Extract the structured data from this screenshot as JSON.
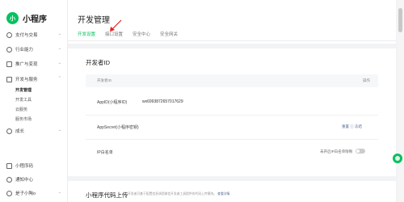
{
  "app": {
    "logo_text": "小",
    "name": "小程序"
  },
  "sidebar": {
    "items": [
      {
        "label": "支付与交易"
      },
      {
        "label": "行业能力"
      },
      {
        "label": "推广与变现"
      },
      {
        "label": "开发与服务"
      },
      {
        "label": "成长"
      },
      {
        "label": "小程序码"
      },
      {
        "label": "通知中心"
      },
      {
        "label": "是子小陶o"
      }
    ],
    "sub_items": [
      {
        "label": "开发管理"
      },
      {
        "label": "开发工具"
      },
      {
        "label": "云服务"
      },
      {
        "label": "服务市场"
      }
    ]
  },
  "header": {
    "title": "开发管理"
  },
  "tabs": [
    {
      "label": "开发设置"
    },
    {
      "label": "接口设置"
    },
    {
      "label": "安全中心"
    },
    {
      "label": "安全网关"
    }
  ],
  "developer_card": {
    "title": "开发者ID",
    "headers": {
      "id": "开发者ID",
      "action": "操作"
    },
    "rows": {
      "appid_label": "AppID(小程序ID)",
      "appid_value": "wx6993872657017629",
      "secret_label": "AppSecret(小程序密钥)",
      "secret_actions": "重置  ⓘ  冻结",
      "ip_label": "IP白名单",
      "ip_toggle_label": "未开启IP白名单限制"
    }
  },
  "code_card": {
    "title": "小程序代码上传",
    "desc": "开发者可基于配置信息调用微信开发者工具提供的代码上传模块。",
    "link": "查看详情"
  },
  "colors": {
    "accent": "#07c160",
    "link": "#576b95"
  }
}
